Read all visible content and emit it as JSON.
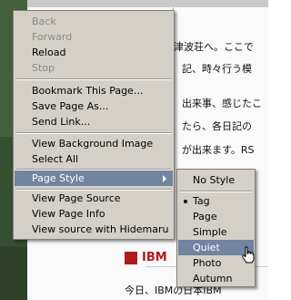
{
  "background": {
    "lines": [
      "津波荘へ。ここで",
      "記、時々行う模",
      "出来事、感じたこ",
      "たら、各日記の",
      "が出来ます。RS",
      "今日、IBMの日本IBM"
    ],
    "ibm_label": "IBM",
    "colors": {
      "ibm_red": "#b01c1c"
    }
  },
  "context_menu": {
    "items": [
      {
        "label": "Back",
        "disabled": true
      },
      {
        "label": "Forward",
        "disabled": true
      },
      {
        "label": "Reload",
        "disabled": false
      },
      {
        "label": "Stop",
        "disabled": true
      },
      {
        "label": "Bookmark This Page...",
        "disabled": false
      },
      {
        "label": "Save Page As...",
        "disabled": false
      },
      {
        "label": "Send Link...",
        "disabled": false
      },
      {
        "label": "View Background Image",
        "disabled": false
      },
      {
        "label": "Select All",
        "disabled": false
      },
      {
        "label": "Page Style",
        "disabled": false,
        "highlighted": true,
        "has_submenu": true
      },
      {
        "label": "View Page Source",
        "disabled": false
      },
      {
        "label": "View Page Info",
        "disabled": false
      },
      {
        "label": "View source with Hidemaru",
        "disabled": false
      }
    ],
    "colors": {
      "highlight": "#7184a0",
      "menu_bg": "#d4d0c8"
    }
  },
  "submenu": {
    "items": [
      {
        "label": "No Style"
      },
      {
        "label": "Tag",
        "selected": true
      },
      {
        "label": "Page"
      },
      {
        "label": "Simple"
      },
      {
        "label": "Quiet",
        "highlighted": true
      },
      {
        "label": "Photo"
      },
      {
        "label": "Autumn"
      }
    ]
  }
}
